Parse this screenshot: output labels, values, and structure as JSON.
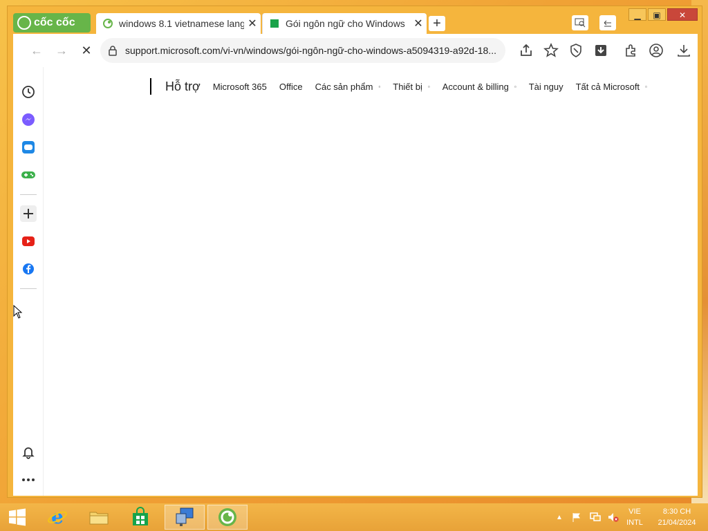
{
  "browser": {
    "brand": "cốc cốc",
    "tabs": [
      {
        "label": "windows 8.1 vietnamese langu",
        "close": "✕"
      },
      {
        "label": "Gói ngôn ngữ cho Windows",
        "close": "✕"
      }
    ],
    "new_tab": "+",
    "url": "support.microsoft.com/vi-vn/windows/gói-ngôn-ngữ-cho-windows-a5094319-a92d-18..."
  },
  "site_nav": {
    "title": "Hỗ trợ",
    "items": [
      {
        "label": "Microsoft 365",
        "caret": ""
      },
      {
        "label": "Office",
        "caret": ""
      },
      {
        "label": "Các sản phẩm",
        "caret": "▫"
      },
      {
        "label": "Thiết bị",
        "caret": "▫"
      },
      {
        "label": "Account & billing",
        "caret": "▫"
      },
      {
        "label": "Tài nguy",
        "caret": ""
      },
      {
        "label": "Tất cả Microsoft",
        "caret": "▫"
      }
    ]
  },
  "taskbar": {
    "language": "VIE",
    "layout": "INTL",
    "time": "8:30 CH",
    "date": "21/04/2024"
  },
  "colors": {
    "brand_green": "#67b549",
    "window_frame": "#f5b53d"
  }
}
